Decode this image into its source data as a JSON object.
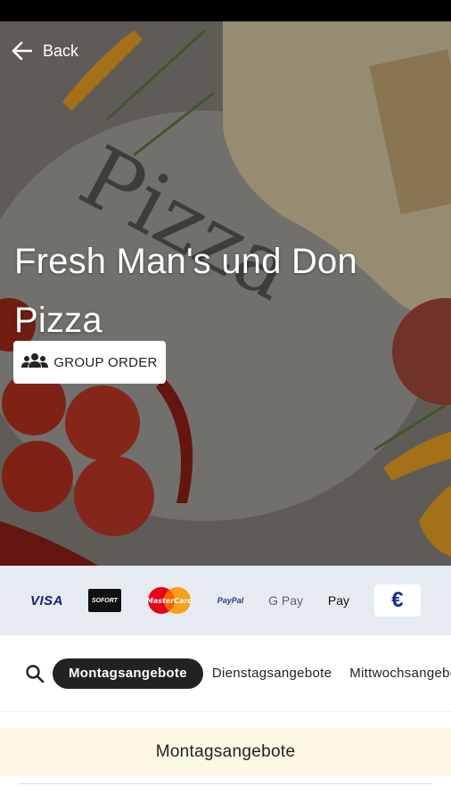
{
  "header": {
    "back_label": "Back"
  },
  "restaurant": {
    "name": "Fresh Man's und Don Pizza"
  },
  "actions": {
    "group_order_label": "GROUP ORDER"
  },
  "payment_methods": {
    "visa": "VISA",
    "sofort": "SOFORT",
    "mastercard": "MasterCard",
    "paypal": "PayPal",
    "google_pay": "G Pay",
    "apple_pay": " Pay",
    "cash": "€"
  },
  "category_tabs": [
    {
      "label": "Montagsangebote",
      "active": true
    },
    {
      "label": "Dienstagsangebote",
      "active": false
    },
    {
      "label": "Mittwochsangebote",
      "active": false
    }
  ],
  "section": {
    "title": "Montagsangebote"
  },
  "colors": {
    "payments_bar": "#e6ebf2",
    "active_tab": "#222222",
    "section_header": "#fdf8e4"
  }
}
